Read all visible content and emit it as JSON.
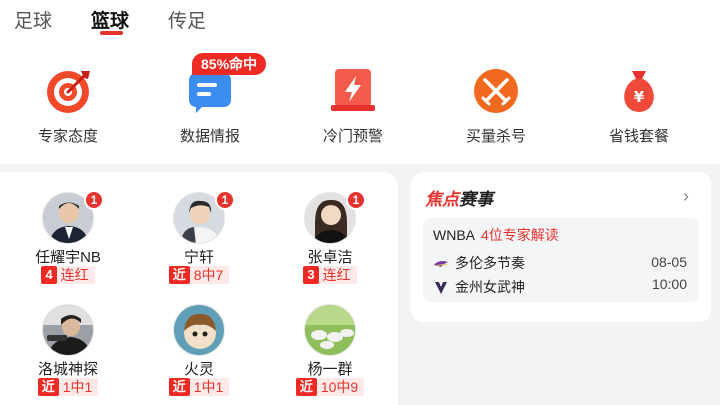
{
  "tabs": [
    {
      "label": "足球",
      "active": false
    },
    {
      "label": "篮球",
      "active": true
    },
    {
      "label": "传足",
      "active": false
    }
  ],
  "features": [
    {
      "label": "专家态度",
      "icon": "target-icon"
    },
    {
      "label": "数据情报",
      "icon": "chat-data-icon"
    },
    {
      "label": "冷门预警",
      "icon": "lightning-alert-icon"
    },
    {
      "label": "买量杀号",
      "icon": "crossed-swords-icon"
    },
    {
      "label": "省钱套餐",
      "icon": "money-bag-icon"
    }
  ],
  "hot_badge": "85%命中",
  "experts": [
    {
      "name": "任耀宇NB",
      "badge": "1",
      "tag": "4",
      "stat": "连红"
    },
    {
      "name": "宁轩",
      "badge": "1",
      "tag": "近",
      "stat": "8中7"
    },
    {
      "name": "张卓洁",
      "badge": "1",
      "tag": "3",
      "stat": "连红"
    },
    {
      "name": "洛城神探",
      "badge": "",
      "tag": "近",
      "stat": "1中1"
    },
    {
      "name": "火灵",
      "badge": "",
      "tag": "近",
      "stat": "1中1"
    },
    {
      "name": "杨一群",
      "badge": "",
      "tag": "近",
      "stat": "10中9"
    }
  ],
  "focus": {
    "title_highlight": "焦点",
    "title_rest": "赛事",
    "arrow": "›",
    "league": "WNBA",
    "expert_count": "4位专家解读",
    "home_team": "多伦多节奏",
    "away_team": "金州女武神",
    "date": "08-05",
    "time": "10:00"
  },
  "colors": {
    "accent": "#e8322d",
    "background": "#f3f3f5"
  }
}
